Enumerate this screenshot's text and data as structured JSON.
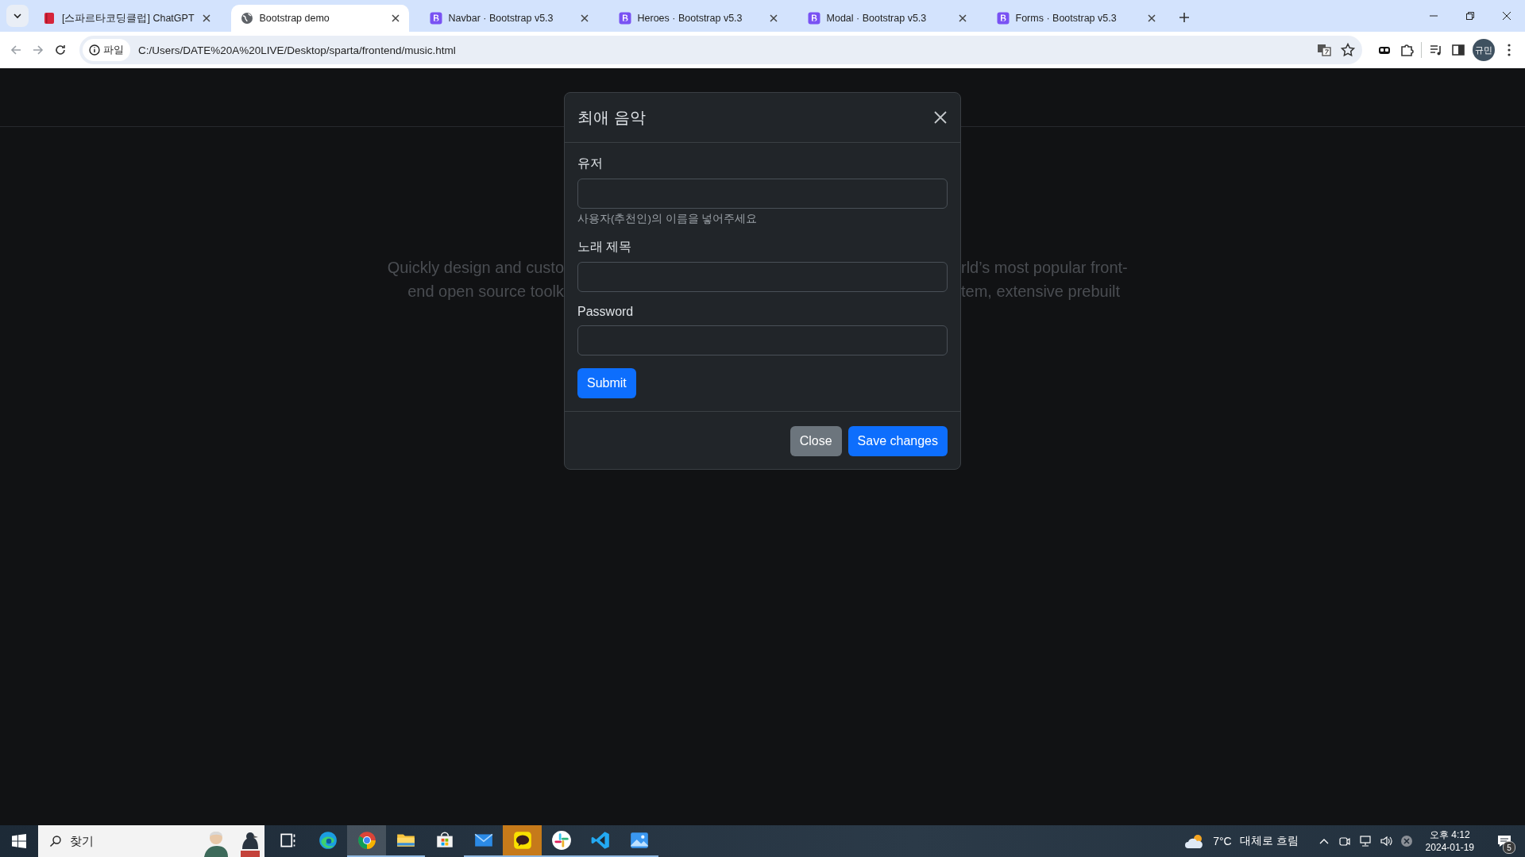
{
  "tabs": [
    {
      "title": "[스파르타코딩클럽] ChatGPT",
      "selected": false
    },
    {
      "title": "Bootstrap demo",
      "selected": true
    },
    {
      "title": "Navbar · Bootstrap v5.3",
      "selected": false
    },
    {
      "title": "Heroes · Bootstrap v5.3",
      "selected": false
    },
    {
      "title": "Modal · Bootstrap v5.3",
      "selected": false
    },
    {
      "title": "Forms · Bootstrap v5.3",
      "selected": false
    }
  ],
  "address_bar": {
    "scheme_chip": "파일",
    "url": "C:/Users/DATE%20A%20LIVE/Desktop/sparta/frontend/music.html"
  },
  "profile": {
    "initials": "규민"
  },
  "page": {
    "lead_lines": [
      {
        "left": "Quickly design and custo",
        "right": "rld’s most popular front-"
      },
      {
        "left": "end open source toolk",
        "right": "tem, extensive prebuilt"
      }
    ]
  },
  "modal": {
    "title": "최애 음악",
    "fields": [
      {
        "label": "유저",
        "help": "사용자(추천인)의 이름을 넣어주세요"
      },
      {
        "label": "노래 제목"
      },
      {
        "label": "Password"
      }
    ],
    "submit": "Submit",
    "footer_buttons": [
      {
        "label": "Close",
        "kind": "secondary"
      },
      {
        "label": "Save changes",
        "kind": "primary"
      }
    ]
  },
  "taskbar": {
    "search_placeholder": "찾기",
    "apps": [
      {
        "kind": "taskview",
        "running": false,
        "selected": false,
        "flashing": false
      },
      {
        "kind": "edge",
        "running": false,
        "selected": false,
        "flashing": false
      },
      {
        "kind": "chrome",
        "running": true,
        "selected": true,
        "flashing": false
      },
      {
        "kind": "folder",
        "running": true,
        "selected": false,
        "flashing": false
      },
      {
        "kind": "store",
        "running": false,
        "selected": false,
        "flashing": false
      },
      {
        "kind": "mail",
        "running": true,
        "selected": false,
        "flashing": false
      },
      {
        "kind": "chat",
        "running": true,
        "selected": false,
        "flashing": true
      },
      {
        "kind": "slack",
        "running": true,
        "selected": false,
        "flashing": false
      },
      {
        "kind": "vscode",
        "running": true,
        "selected": false,
        "flashing": false
      },
      {
        "kind": "photos",
        "running": true,
        "selected": false,
        "flashing": false
      }
    ],
    "weather": {
      "temperature": "7°C",
      "condition": "대체로 흐림"
    },
    "clock": {
      "time": "오후 4:12",
      "date": "2024-01-19"
    },
    "notifications": {
      "count": "5"
    }
  }
}
